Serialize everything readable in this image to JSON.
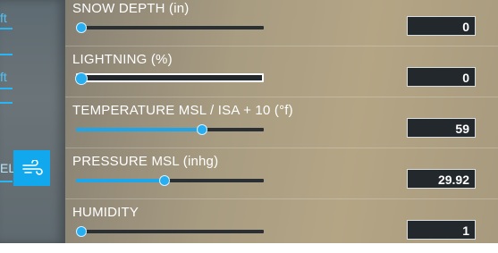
{
  "sidebar": {
    "labels": [
      "ft",
      "ft",
      "EL"
    ],
    "active_tab_icon": "wind-icon"
  },
  "settings": [
    {
      "label": "SNOW DEPTH (in)",
      "value": "0",
      "slider_fraction": 0.0
    },
    {
      "label": "LIGHTNING (%)",
      "value": "0",
      "slider_fraction": 0.0
    },
    {
      "label": "TEMPERATURE MSL / ISA + 10 (°f)",
      "value": "59",
      "slider_fraction": 0.68
    },
    {
      "label": "PRESSURE MSL (inhg)",
      "value": "29.92",
      "slider_fraction": 0.47
    },
    {
      "label": "HUMIDITY",
      "value": "1",
      "slider_fraction": 0.0
    }
  ],
  "colors": {
    "accent": "#1fa6ea",
    "text": "#ffffff"
  }
}
